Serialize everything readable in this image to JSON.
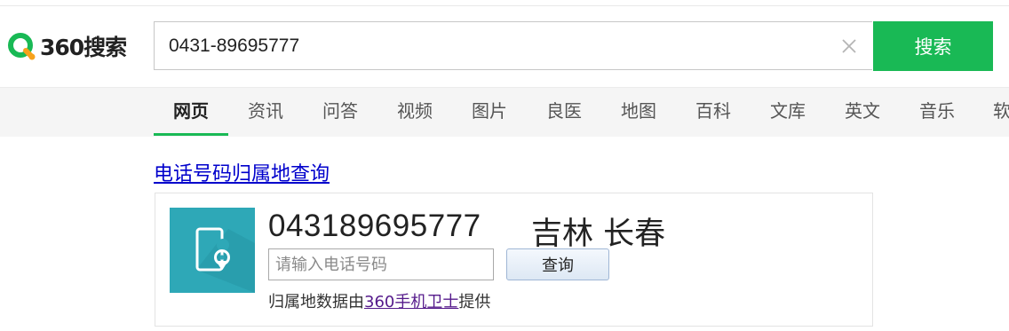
{
  "header": {
    "logo_text": "360搜索",
    "search_value": "0431-89695777",
    "search_button": "搜索"
  },
  "tabs": [
    {
      "label": "网页",
      "active": true
    },
    {
      "label": "资讯"
    },
    {
      "label": "问答"
    },
    {
      "label": "视频"
    },
    {
      "label": "图片"
    },
    {
      "label": "良医"
    },
    {
      "label": "地图"
    },
    {
      "label": "百科"
    },
    {
      "label": "文库"
    },
    {
      "label": "英文"
    },
    {
      "label": "音乐"
    },
    {
      "label": "软"
    }
  ],
  "result": {
    "title": "电话号码归属地查询",
    "phone_number": "043189695777",
    "location": "吉林 长春",
    "input_placeholder": "请输入电话号码",
    "query_button": "查询",
    "source_prefix": "归属地数据由",
    "source_link": "360手机卫士",
    "source_suffix": "提供"
  },
  "colors": {
    "brand_green": "#19b955",
    "icon_teal": "#2ea8b7",
    "link_blue": "#0000cc",
    "visited_purple": "#551a8b"
  },
  "icons": [
    "logo-icon",
    "clear-icon",
    "phone-location-icon"
  ]
}
